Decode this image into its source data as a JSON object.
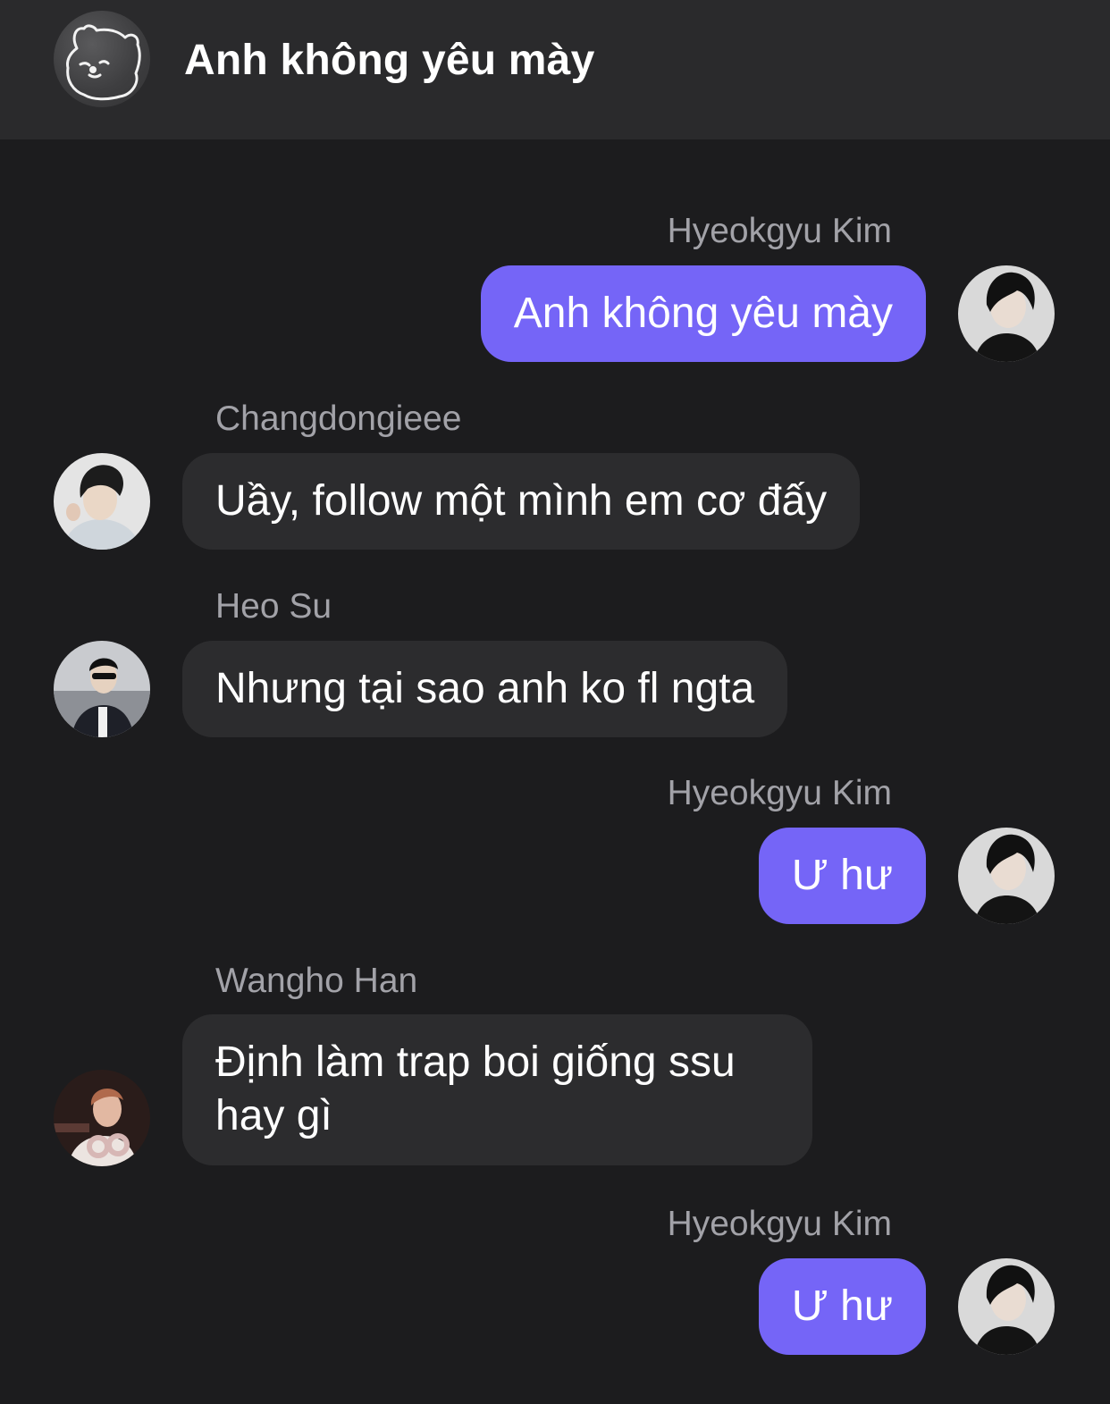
{
  "header": {
    "title": "Anh không yêu mày",
    "group_avatar_icon": "bear-icon"
  },
  "messages": [
    {
      "sender": "Hyeokgyu Kim",
      "text": "Anh không yêu mày",
      "direction": "outgoing"
    },
    {
      "sender": "Changdongieee",
      "text": "Uầy, follow một mình em cơ đấy",
      "direction": "incoming"
    },
    {
      "sender": "Heo Su",
      "text": "Nhưng tại sao anh ko fl ngta",
      "direction": "incoming"
    },
    {
      "sender": "Hyeokgyu Kim",
      "text": "Ư hư",
      "direction": "outgoing"
    },
    {
      "sender": "Wangho Han",
      "text": "Định làm trap boi giống ssu hay gì",
      "direction": "incoming"
    },
    {
      "sender": "Hyeokgyu Kim",
      "text": "Ư hư",
      "direction": "outgoing"
    }
  ],
  "colors": {
    "background": "#1c1c1e",
    "header": "#2a2a2c",
    "outgoing_bubble": "#7565f7",
    "incoming_bubble": "#2c2c2e",
    "sender_name": "#a2a2a8"
  }
}
